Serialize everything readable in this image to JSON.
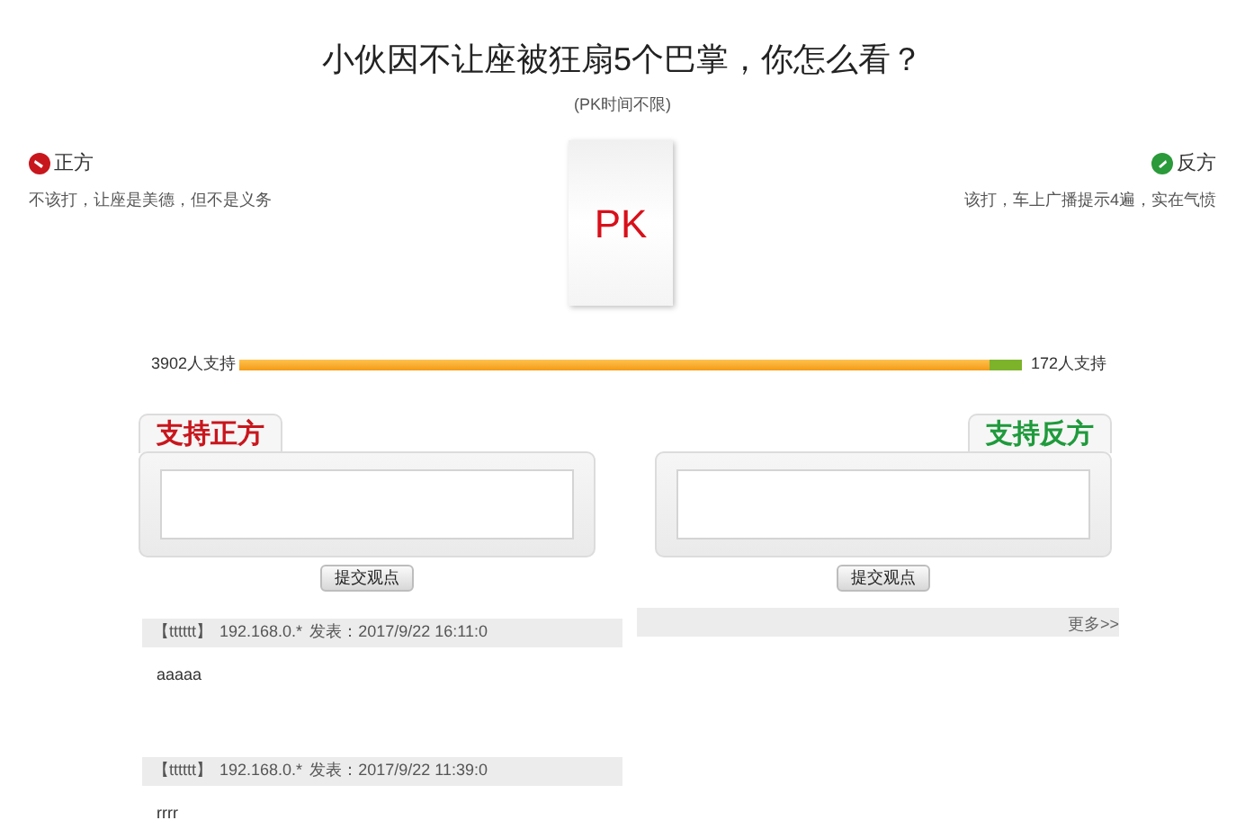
{
  "title": "小伙因不让座被狂扇5个巴掌，你怎么看？",
  "subtitle": "(PK时间不限)",
  "pro": {
    "label": "正方",
    "argument": "不该打，让座是美德，但不是义务",
    "support": "3902人支持",
    "panel_title": "支持正方",
    "button": "提交观点"
  },
  "con": {
    "label": "反方",
    "argument": "该打，车上广播提示4遍，实在气愤",
    "support": "172人支持",
    "panel_title": "支持反方",
    "button": "提交观点"
  },
  "pk_badge": "PK",
  "vote_bar": {
    "level": 0.958
  },
  "comments": [
    {
      "author": "【tttttt】",
      "ip": "192.168.0.*",
      "posted": "发表：2017/9/22 16:11:0",
      "text": "aaaaa"
    },
    {
      "author": "【tttttt】",
      "ip": "192.168.0.*",
      "posted": "发表：2017/9/22 11:39:0",
      "text": "rrrr"
    }
  ],
  "more_link": "更多>>"
}
